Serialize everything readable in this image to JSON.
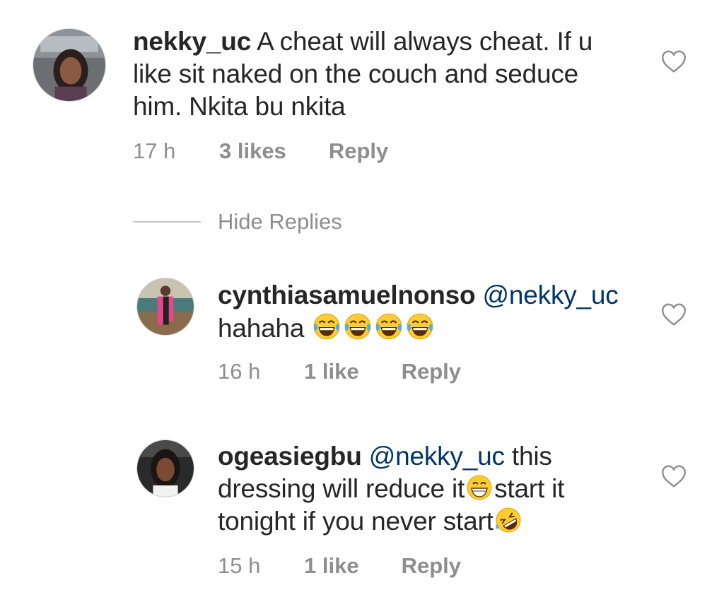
{
  "comments": [
    {
      "username": "nekky_uc",
      "lines": [
        "A cheat will always cheat. If u",
        "like sit naked on the couch and seduce",
        "him. Nkita bu nkita"
      ],
      "time": "17 h",
      "likes": "3 likes",
      "reply": "Reply",
      "avatar_icon": "woman-selfie-car-avatar"
    },
    {
      "username": "cynthiasamuelnonso",
      "mention": "@nekky_uc",
      "text_line2": "hahaha",
      "emojis": [
        "tears-of-joy",
        "tears-of-joy",
        "tears-of-joy",
        "tears-of-joy"
      ],
      "time": "16 h",
      "likes": "1 like",
      "reply": "Reply",
      "avatar_icon": "woman-pink-outfit-avatar"
    },
    {
      "username": "ogeasiegbu",
      "mention": "@nekky_uc",
      "part1": "this",
      "part2": "dressing will reduce it",
      "part3": "start it",
      "part4": "tonight if you never start",
      "emojis": [
        "grinning-face",
        "rolling-on-floor-laughing"
      ],
      "time": "15 h",
      "likes": "1 like",
      "reply": "Reply",
      "avatar_icon": "woman-selfie-avatar"
    }
  ],
  "hide_replies": "Hide Replies",
  "colors": {
    "text": "#262626",
    "meta": "#8e8e8e",
    "mention": "#003569",
    "heart": "#8e8e8e"
  }
}
